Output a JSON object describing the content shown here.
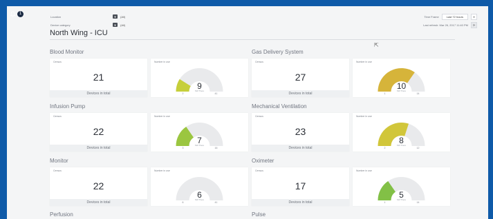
{
  "header": {
    "notification_count": "1",
    "filters": [
      {
        "label": "Location",
        "value": "(All)"
      },
      {
        "label": "Device category",
        "value": "(All)"
      }
    ],
    "time_frame_label": "Time Frame",
    "time_frame_value": "Last 72 hours",
    "last_refresh_label": "Last refresh: Mar 26, 2017 11:40 PM"
  },
  "page_title": "North Wing - ICU",
  "labels": {
    "census": "Census",
    "devices_in_total": "Devices in total",
    "number_in_use": "Number in use",
    "still_there": "Still There"
  },
  "sections": [
    {
      "name": "Blood Monitor",
      "census": 21,
      "in_use": 9,
      "min": 2,
      "max": 41,
      "color": "#c6cf3a"
    },
    {
      "name": "Gas Delivery System",
      "census": 27,
      "in_use": 10,
      "min": 1,
      "max": 14,
      "color": "#d6b43a"
    },
    {
      "name": "Infusion Pump",
      "census": 22,
      "in_use": 7,
      "min": 3,
      "max": 16,
      "color": "#9bc640"
    },
    {
      "name": "Mechanical Ventilation",
      "census": 23,
      "in_use": 8,
      "min": 2,
      "max": 12,
      "color": "#d1c63a"
    },
    {
      "name": "Monitor",
      "census": 22,
      "in_use": 6,
      "min": 6,
      "max": 41,
      "color": "#c7d33b"
    },
    {
      "name": "Oximeter",
      "census": 17,
      "in_use": 5,
      "min": 1,
      "max": 14,
      "color": "#82c046"
    },
    {
      "name": "Perfusion"
    },
    {
      "name": "Pulse"
    }
  ]
}
